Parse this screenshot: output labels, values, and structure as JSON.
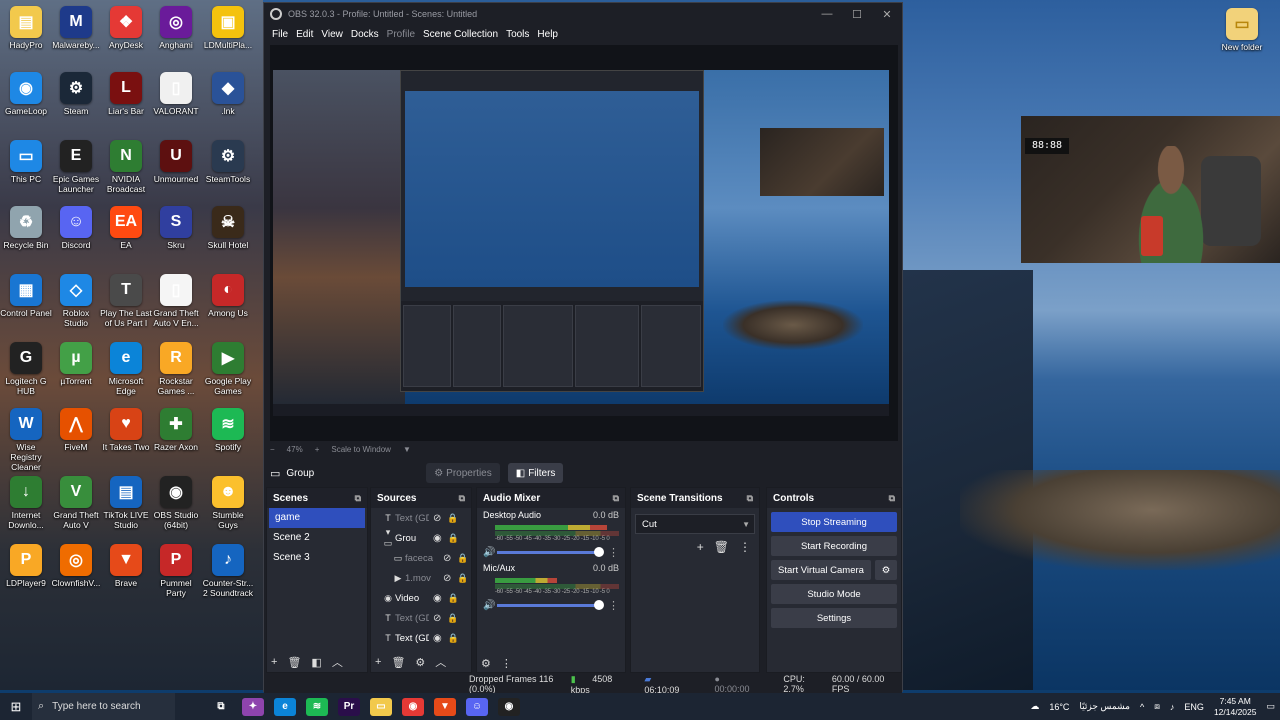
{
  "desktop": {
    "icons": [
      {
        "label": "HadyPro",
        "glyph": "▤",
        "color": "#f2c94c"
      },
      {
        "label": "Malwareby...",
        "glyph": "M",
        "color": "#1e3a8a"
      },
      {
        "label": "AnyDesk",
        "glyph": "❖",
        "color": "#e53935"
      },
      {
        "label": "Anghami",
        "glyph": "◎",
        "color": "#6a1b9a"
      },
      {
        "label": "LDMultiPla...",
        "glyph": "▣",
        "color": "#f4c20d"
      },
      {
        "label": "GameLoop",
        "glyph": "◉",
        "color": "#1e88e5"
      },
      {
        "label": "Steam",
        "glyph": "⚙",
        "color": "#1b2838"
      },
      {
        "label": "Liar's Bar",
        "glyph": "L",
        "color": "#7a1010"
      },
      {
        "label": "VALORANT",
        "glyph": "▯",
        "color": "#f0f0f0"
      },
      {
        "label": ".lnk",
        "glyph": "◆",
        "color": "#2a5298"
      },
      {
        "label": "This PC",
        "glyph": "▭",
        "color": "#1e88e5"
      },
      {
        "label": "Epic Games Launcher",
        "glyph": "E",
        "color": "#222222"
      },
      {
        "label": "NVIDIA Broadcast",
        "glyph": "N",
        "color": "#2e7d32"
      },
      {
        "label": "Unmourned",
        "glyph": "U",
        "color": "#5d1010"
      },
      {
        "label": "SteamTools",
        "glyph": "⚙",
        "color": "#2a3a50"
      },
      {
        "label": "Recycle Bin",
        "glyph": "♻",
        "color": "#90a4ae"
      },
      {
        "label": "Discord",
        "glyph": "☺",
        "color": "#5865f2"
      },
      {
        "label": "EA",
        "glyph": "EA",
        "color": "#ff4a11"
      },
      {
        "label": "Skru",
        "glyph": "S",
        "color": "#303f9f"
      },
      {
        "label": "Skull Hotel",
        "glyph": "☠",
        "color": "#3a2a1a"
      },
      {
        "label": "Control Panel",
        "glyph": "▦",
        "color": "#1976d2"
      },
      {
        "label": "Roblox Studio",
        "glyph": "◇",
        "color": "#1e88e5"
      },
      {
        "label": "Play The Last of Us Part I",
        "glyph": "T",
        "color": "#4a4a4a"
      },
      {
        "label": "Grand Theft Auto V En...",
        "glyph": "▯",
        "color": "#f5f5f5"
      },
      {
        "label": "Among Us",
        "glyph": "◐",
        "color": "#c62828"
      },
      {
        "label": "Logitech G HUB",
        "glyph": "G",
        "color": "#222222"
      },
      {
        "label": "µTorrent",
        "glyph": "µ",
        "color": "#43a047"
      },
      {
        "label": "Microsoft Edge",
        "glyph": "e",
        "color": "#0b84d8"
      },
      {
        "label": "Rockstar Games ...",
        "glyph": "R",
        "color": "#f9a825"
      },
      {
        "label": "Google Play Games",
        "glyph": "▶",
        "color": "#2e7d32"
      },
      {
        "label": "Wise Registry Cleaner",
        "glyph": "W",
        "color": "#1565c0"
      },
      {
        "label": "FiveM",
        "glyph": "⋀",
        "color": "#e65100"
      },
      {
        "label": "It Takes Two",
        "glyph": "♥",
        "color": "#d84315"
      },
      {
        "label": "Razer Axon",
        "glyph": "✚",
        "color": "#2e7d32"
      },
      {
        "label": "Spotify",
        "glyph": "≋",
        "color": "#1db954"
      },
      {
        "label": "Internet Downlo...",
        "glyph": "↓",
        "color": "#2e7d32"
      },
      {
        "label": "Grand Theft Auto V",
        "glyph": "V",
        "color": "#388e3c"
      },
      {
        "label": "TikTok LIVE Studio",
        "glyph": "▤",
        "color": "#1565c0"
      },
      {
        "label": "OBS Studio (64bit)",
        "glyph": "◉",
        "color": "#222222"
      },
      {
        "label": "Stumble Guys",
        "glyph": "☻",
        "color": "#fbc02d"
      },
      {
        "label": "LDPlayer9",
        "glyph": "P",
        "color": "#f9a825"
      },
      {
        "label": "ClownfishV...",
        "glyph": "◎",
        "color": "#ef6c00"
      },
      {
        "label": "Brave",
        "glyph": "▼",
        "color": "#e64a19"
      },
      {
        "label": "Pummel Party",
        "glyph": "P",
        "color": "#c62828"
      },
      {
        "label": "Counter-Str... 2 Soundtrack",
        "glyph": "♪",
        "color": "#1565c0"
      }
    ],
    "new_folder_label": "New folder",
    "webcam_clock": "88:88"
  },
  "obs": {
    "title": "OBS 32.0.3 - Profile: Untitled - Scenes: Untitled",
    "window_controls": [
      "—",
      "☐",
      "✕"
    ],
    "menu": [
      {
        "label": "File",
        "enabled": true
      },
      {
        "label": "Edit",
        "enabled": true
      },
      {
        "label": "View",
        "enabled": true
      },
      {
        "label": "Docks",
        "enabled": true
      },
      {
        "label": "Profile",
        "enabled": false
      },
      {
        "label": "Scene Collection",
        "enabled": true
      },
      {
        "label": "Tools",
        "enabled": true
      },
      {
        "label": "Help",
        "enabled": true
      }
    ],
    "preview": {
      "zoom_minus": "−",
      "zoom": "47%",
      "zoom_plus": "+",
      "scale_mode": "Scale to Window",
      "scale_arrow": "▼"
    },
    "current_scene_label": "Group",
    "tabs": {
      "properties": "Properties",
      "filters": "Filters"
    },
    "scenes": {
      "title": "Scenes",
      "items": [
        {
          "name": "game",
          "active": true
        },
        {
          "name": "Scene 2",
          "active": false
        },
        {
          "name": "Scene 3",
          "active": false
        }
      ]
    },
    "sources": {
      "title": "Sources",
      "items": [
        {
          "name": "Text (GD",
          "icon": "T",
          "indent": 0,
          "visible": false
        },
        {
          "name": "Grou",
          "icon": "▾ ▭",
          "indent": 0,
          "visible": true
        },
        {
          "name": "faceca",
          "icon": "▭",
          "indent": 1,
          "visible": false
        },
        {
          "name": "1.mov",
          "icon": "▶",
          "indent": 1,
          "visible": false
        },
        {
          "name": "Video",
          "icon": "◉",
          "indent": 0,
          "visible": true
        },
        {
          "name": "Text (GD",
          "icon": "T",
          "indent": 0,
          "visible": false
        },
        {
          "name": "Text (GD",
          "icon": "T",
          "indent": 0,
          "visible": true
        }
      ]
    },
    "audio_mixer": {
      "title": "Audio Mixer",
      "channels": [
        {
          "name": "Desktop Audio",
          "db": "0.0 dB",
          "level": 0.9
        },
        {
          "name": "Mic/Aux",
          "db": "0.0 dB",
          "level": 0.5
        }
      ],
      "ticks": "-60 -55 -50 -45 -40 -35 -30 -25 -20 -15 -10 -5 0"
    },
    "scene_transitions": {
      "title": "Scene Transitions",
      "selected": "Cut"
    },
    "controls": {
      "title": "Controls",
      "buttons": {
        "stop_streaming": "Stop Streaming",
        "start_recording": "Start Recording",
        "start_virtual_camera": "Start Virtual Camera",
        "studio_mode": "Studio Mode",
        "settings": "Settings"
      }
    },
    "status": {
      "dropped_frames": "Dropped Frames 116 (0.0%)",
      "bitrate": "4508 kbps",
      "stream_time": "06:10:09",
      "record_time": "00:00:00",
      "cpu": "CPU: 2.7%",
      "fps": "60.00 / 60.00 FPS"
    }
  },
  "taskbar": {
    "search_placeholder": "Type here to search",
    "apps": [
      {
        "name": "task-view",
        "glyph": "⧉",
        "color": "#1c2533"
      },
      {
        "name": "copilot",
        "glyph": "✦",
        "color": "#8e44ad"
      },
      {
        "name": "edge",
        "glyph": "e",
        "color": "#0b84d8"
      },
      {
        "name": "spotify",
        "glyph": "≋",
        "color": "#1db954"
      },
      {
        "name": "premiere",
        "glyph": "Pr",
        "color": "#2a0e4a"
      },
      {
        "name": "file-explorer",
        "glyph": "▭",
        "color": "#f2c94c"
      },
      {
        "name": "chrome",
        "glyph": "◉",
        "color": "#e53935"
      },
      {
        "name": "brave",
        "glyph": "▼",
        "color": "#e64a19"
      },
      {
        "name": "discord",
        "glyph": "☺",
        "color": "#5865f2"
      },
      {
        "name": "obs",
        "glyph": "◉",
        "color": "#222222"
      }
    ],
    "weather": "16°C",
    "weather_text": "مشمس جزئيًا",
    "language": "ENG",
    "time": "7:45 AM",
    "date": "12/14/2025"
  }
}
